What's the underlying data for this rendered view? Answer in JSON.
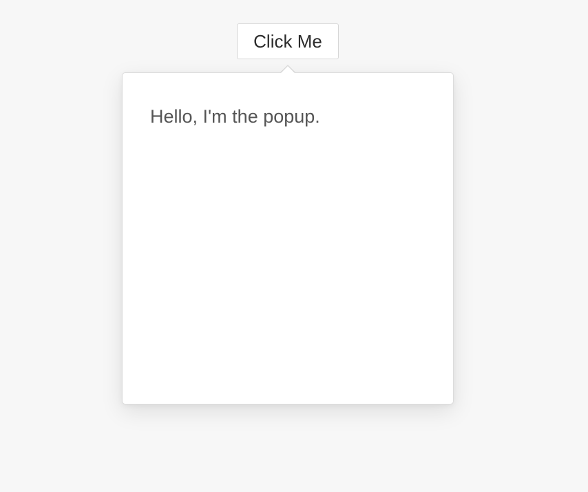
{
  "trigger": {
    "label": "Click Me"
  },
  "popup": {
    "message": "Hello, I'm the popup."
  },
  "colors": {
    "background": "#f7f7f7",
    "popup_background": "#ffffff",
    "border": "#dcdcdc",
    "text": "#555555",
    "button_text": "#2b2b2b"
  }
}
